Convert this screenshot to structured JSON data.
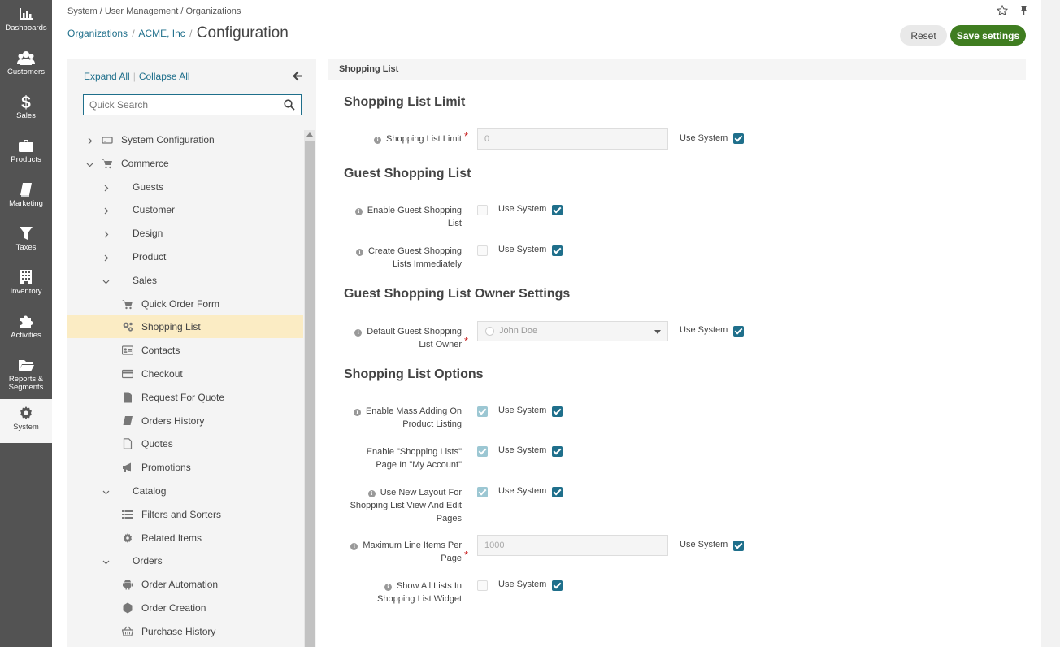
{
  "app_menu": [
    {
      "label": "Dashboards",
      "icon": "dashboards-icon"
    },
    {
      "label": "Customers",
      "icon": "customers-icon"
    },
    {
      "label": "Sales",
      "icon": "dollar-icon"
    },
    {
      "label": "Products",
      "icon": "briefcase-icon"
    },
    {
      "label": "Marketing",
      "icon": "book-icon"
    },
    {
      "label": "Taxes",
      "icon": "filter-icon"
    },
    {
      "label": "Inventory",
      "icon": "building-icon"
    },
    {
      "label": "Activities",
      "icon": "puzzle-icon"
    },
    {
      "label": "Reports &",
      "label2": "Segments",
      "icon": "folder-icon"
    },
    {
      "label": "System",
      "icon": "gear-icon",
      "active": true
    }
  ],
  "header": {
    "top_breadcrumb": "System / User Management / Organizations",
    "crumb1": "Organizations",
    "crumb2": "ACME, Inc",
    "sep": "/",
    "title": "Configuration",
    "reset_label": "Reset",
    "save_label": "Save settings"
  },
  "sidebar": {
    "expand_all": "Expand All",
    "collapse_all": "Collapse All",
    "divider": "|",
    "search_placeholder": "Quick Search",
    "tree": [
      {
        "label": "System Configuration",
        "level": 0,
        "chevron": "right",
        "icon": "drive-icon"
      },
      {
        "label": "Commerce",
        "level": 0,
        "chevron": "down",
        "icon": "cart-icon"
      },
      {
        "label": "Guests",
        "level": 1,
        "chevron": "right"
      },
      {
        "label": "Customer",
        "level": 1,
        "chevron": "right"
      },
      {
        "label": "Design",
        "level": 1,
        "chevron": "right"
      },
      {
        "label": "Product",
        "level": 1,
        "chevron": "right"
      },
      {
        "label": "Sales",
        "level": 1,
        "chevron": "down"
      },
      {
        "label": "Quick Order Form",
        "level": 2,
        "icon": "cart-icon"
      },
      {
        "label": "Shopping List",
        "level": 2,
        "icon": "cogs-icon",
        "selected": true
      },
      {
        "label": "Contacts",
        "level": 2,
        "icon": "contact-card-icon"
      },
      {
        "label": "Checkout",
        "level": 2,
        "icon": "credit-card-icon"
      },
      {
        "label": "Request For Quote",
        "level": 2,
        "icon": "file-icon"
      },
      {
        "label": "Orders History",
        "level": 2,
        "icon": "book-icon"
      },
      {
        "label": "Quotes",
        "level": 2,
        "icon": "file-outline-icon"
      },
      {
        "label": "Promotions",
        "level": 2,
        "icon": "bullhorn-icon"
      },
      {
        "label": "Catalog",
        "level": 1,
        "chevron": "down"
      },
      {
        "label": "Filters and Sorters",
        "level": 2,
        "icon": "list-icon"
      },
      {
        "label": "Related Items",
        "level": 2,
        "icon": "gear-icon"
      },
      {
        "label": "Orders",
        "level": 1,
        "chevron": "down"
      },
      {
        "label": "Order Automation",
        "level": 2,
        "icon": "android-icon"
      },
      {
        "label": "Order Creation",
        "level": 2,
        "icon": "hexagon-icon"
      },
      {
        "label": "Purchase History",
        "level": 2,
        "icon": "basket-icon"
      }
    ]
  },
  "content": {
    "section_title": "Shopping List",
    "use_system": "Use System",
    "groups": {
      "limit": "Shopping List Limit",
      "guest": "Guest Shopping List",
      "owner": "Guest Shopping List Owner Settings",
      "options": "Shopping List Options"
    },
    "fields": {
      "limit": {
        "l1": "Shopping List Limit",
        "value": "0"
      },
      "enable_guest": {
        "l1": "Enable Guest Shopping",
        "l2": "List"
      },
      "create_guest": {
        "l1": "Create Guest Shopping",
        "l2": "Lists Immediately"
      },
      "default_owner": {
        "l1": "Default Guest Shopping",
        "l2": "List Owner",
        "value": "John Doe"
      },
      "mass_adding": {
        "l1": "Enable Mass Adding On",
        "l2": "Product Listing"
      },
      "my_account": {
        "l1": "Enable \"Shopping Lists\"",
        "l2": "Page In \"My Account\""
      },
      "new_layout": {
        "l1": "Use New Layout For",
        "l2": "Shopping List View And Edit",
        "l3": "Pages"
      },
      "max_items": {
        "l1": "Maximum Line Items Per",
        "l2": "Page",
        "value": "1000"
      },
      "show_all": {
        "l1": "Show All Lists In",
        "l2": "Shopping List Widget"
      }
    }
  },
  "colors": {
    "accent": "#1f6f8b",
    "save": "#3f7d20",
    "menu": "#535353",
    "selected": "#fbecc4"
  }
}
